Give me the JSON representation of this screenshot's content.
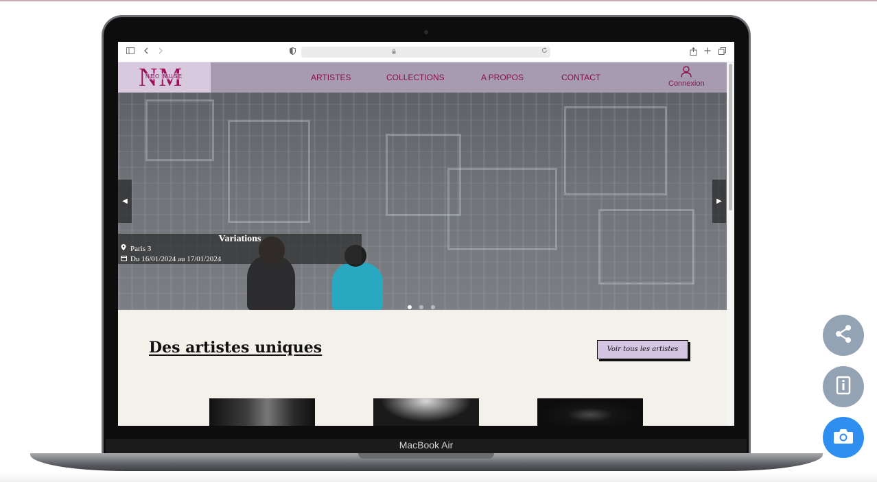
{
  "device": {
    "label": "MacBook Air"
  },
  "browser": {
    "url": ""
  },
  "site": {
    "logo": {
      "letters": "NM",
      "subtitle": "NEO MUSE"
    },
    "nav": [
      {
        "label": "ARTISTES"
      },
      {
        "label": "COLLECTIONS"
      },
      {
        "label": "A PROPOS"
      },
      {
        "label": "CONTACT"
      }
    ],
    "login_label": "Connexion",
    "hero": {
      "title": "Variations",
      "location": "Paris 3",
      "dates": "Du 16/01/2024 au 17/01/2024",
      "slide_count": 3,
      "active_slide": 1
    },
    "section": {
      "title": "Des artistes uniques",
      "button_label": "Voir tous les artistes"
    }
  },
  "floating_actions": [
    "share-icon",
    "document-icon",
    "camera-icon"
  ],
  "colors": {
    "header_bg": "#a79bb0",
    "logo_bg": "#d8c9df",
    "brand": "#8a0f4e",
    "section_bg": "#f3f1ea",
    "button_bg": "#d4c6e3",
    "camera_fab": "#2e8ff0",
    "grey_fab": "#94a3b4"
  }
}
